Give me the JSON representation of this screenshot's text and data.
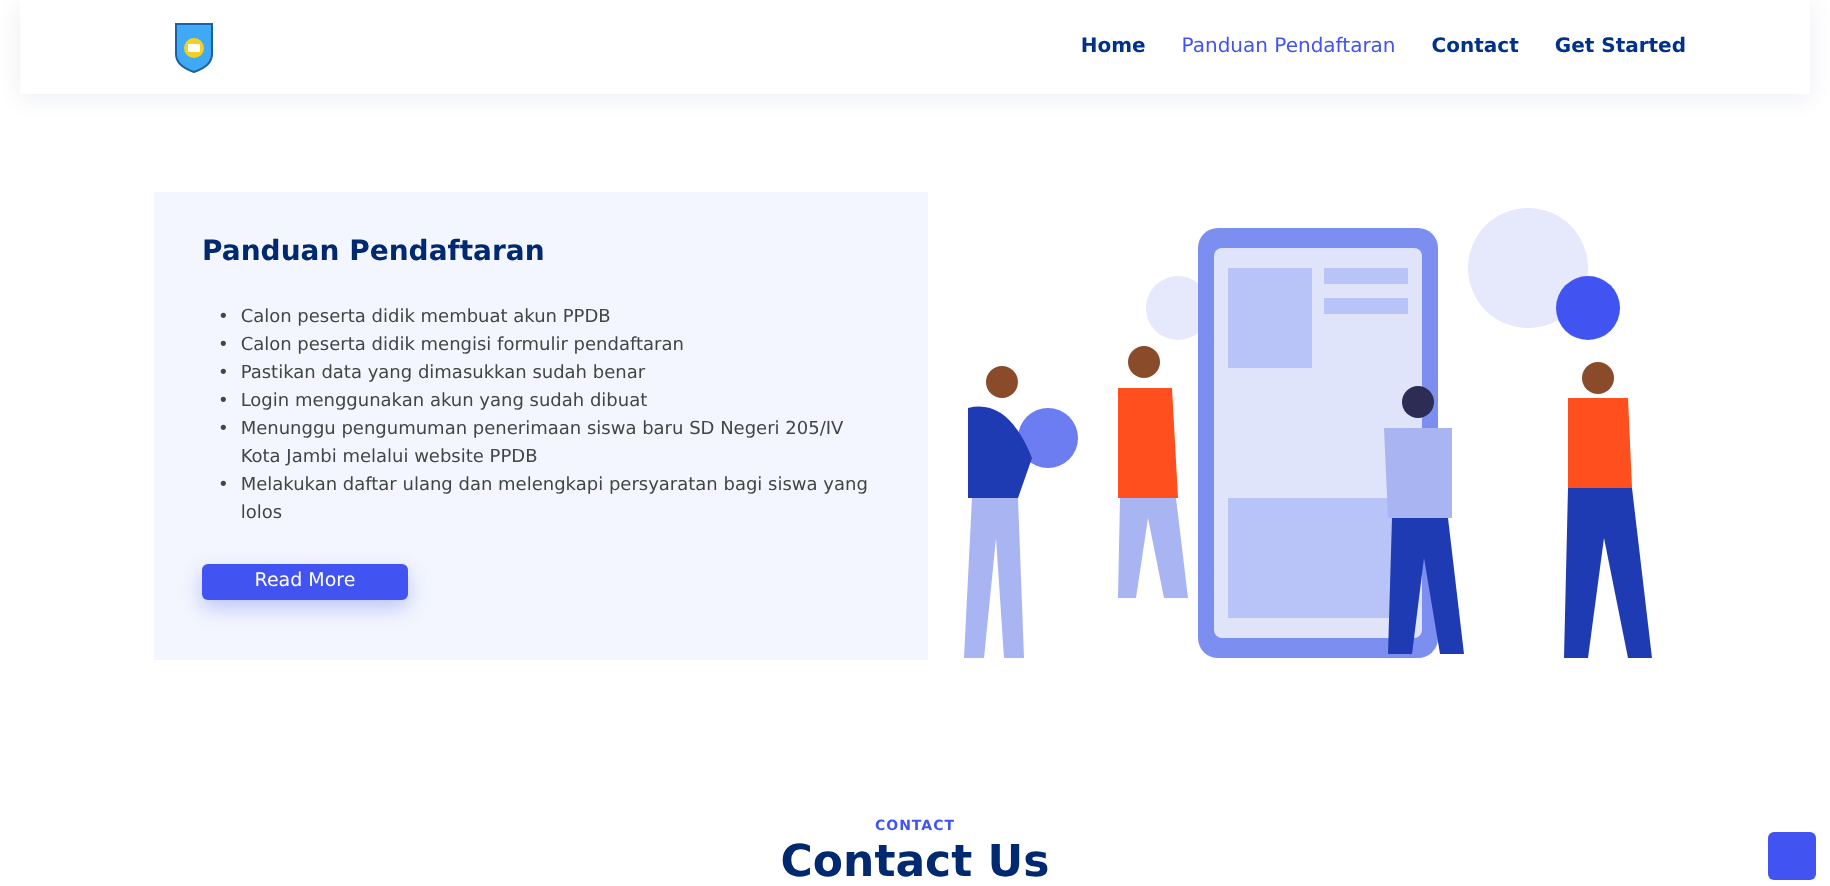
{
  "nav": {
    "items": [
      {
        "label": "Home",
        "selected": false
      },
      {
        "label": "Panduan Pendaftaran",
        "selected": true
      },
      {
        "label": "Contact",
        "selected": false
      },
      {
        "label": "Get Started",
        "selected": false
      }
    ]
  },
  "guide": {
    "title": "Panduan Pendaftaran",
    "steps": [
      "Calon peserta didik membuat akun PPDB",
      "Calon peserta didik mengisi formulir pendaftaran",
      "Pastikan data yang dimasukkan sudah benar",
      "Login menggunakan akun yang sudah dibuat",
      "Menunggu pengumuman penerimaan siswa baru SD Negeri 205/IV Kota Jambi melalui website PPDB",
      "Melakukan daftar ulang dan melengkapi persyaratan bagi siswa yang lolos"
    ],
    "bullet": "•",
    "button": "Read More"
  },
  "contact": {
    "label": "CONTACT",
    "title": "Contact Us"
  }
}
